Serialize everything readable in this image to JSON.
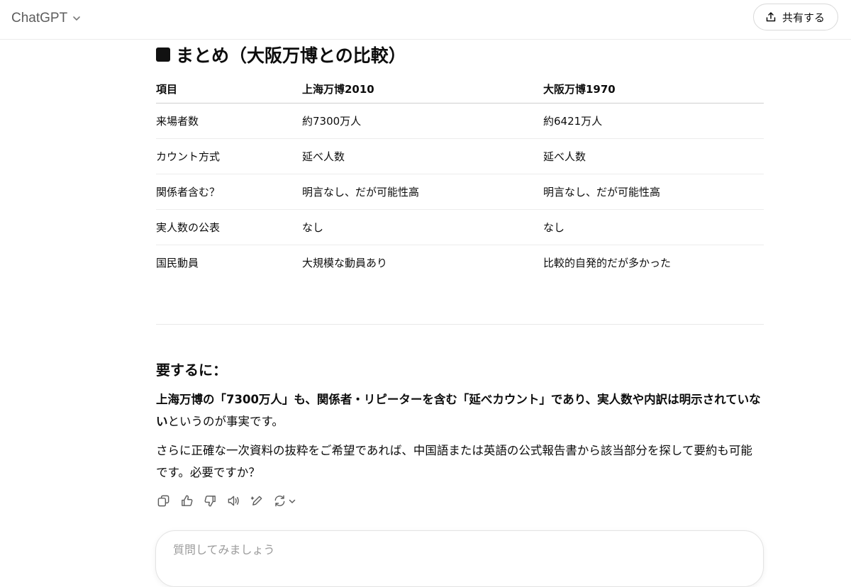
{
  "header": {
    "model_name": "ChatGPT",
    "share_label": "共有する"
  },
  "message": {
    "section_title": "まとめ（大阪万博との比較）",
    "table": {
      "headers": [
        "項目",
        "上海万博2010",
        "大阪万博1970"
      ],
      "rows": [
        [
          "来場者数",
          "約7300万人",
          "約6421万人"
        ],
        [
          "カウント方式",
          "延べ人数",
          "延べ人数"
        ],
        [
          "関係者含む？",
          "明言なし、だが可能性高",
          "明言なし、だが可能性高"
        ],
        [
          "実人数の公表",
          "なし",
          "なし"
        ],
        [
          "国民動員",
          "大規模な動員あり",
          "比較的自発的だが多かった"
        ]
      ]
    },
    "summary_title": "要するに：",
    "summary_bold": "上海万博の「7300万人」も、関係者・リピーターを含む「延べカウント」であり、実人数や内訳は明示されていない",
    "summary_rest": "というのが事実です。",
    "followup": "さらに正確な一次資料の抜粋をご希望であれば、中国語または英語の公式報告書から該当部分を探して要約も可能です。必要ですか？"
  },
  "actions": {
    "icons": [
      "copy-icon",
      "thumbs-up-icon",
      "thumbs-down-icon",
      "read-aloud-icon",
      "edit-canvas-icon",
      "regenerate-icon",
      "chevron-down-icon"
    ]
  },
  "composer": {
    "placeholder": "質問してみましょう"
  }
}
